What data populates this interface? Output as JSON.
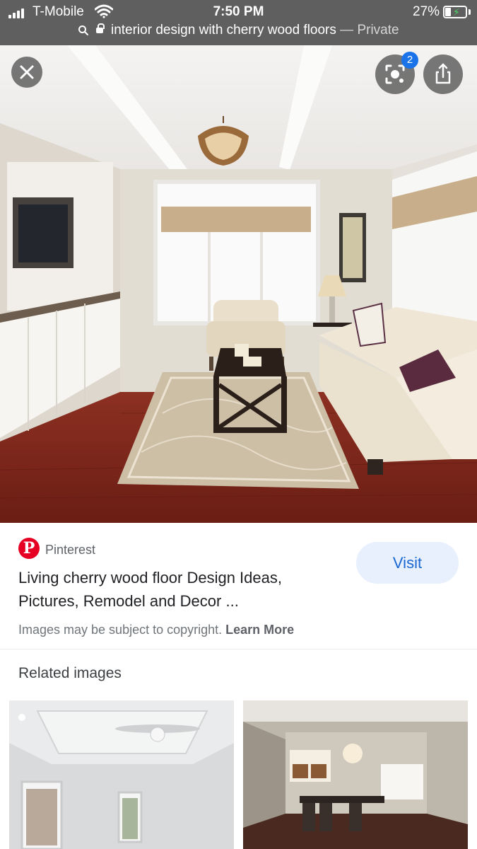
{
  "status_bar": {
    "carrier": "T-Mobile",
    "time": "7:50 PM",
    "battery": "27%"
  },
  "url_bar": {
    "query": "interior design with cherry wood floors",
    "mode": "— Private"
  },
  "viewer": {
    "close_icon": "close-icon",
    "lens_icon": "lens-icon",
    "lens_badge": "2",
    "share_icon": "share-icon"
  },
  "result": {
    "source": "Pinterest",
    "title_line1": "Living cherry wood floor Design Ideas,",
    "title_line2": "Pictures, Remodel and Decor ...",
    "visit_label": "Visit",
    "copyright_text": "Images may be subject to copyright.",
    "learn_more": "Learn More"
  },
  "related": {
    "title": "Related images"
  },
  "colors": {
    "topbar": "#5f5f5f",
    "pinterest_red": "#e60023",
    "visit_bg": "#e8f0fe",
    "visit_text": "#1967d2",
    "floor": "#7a2418"
  }
}
